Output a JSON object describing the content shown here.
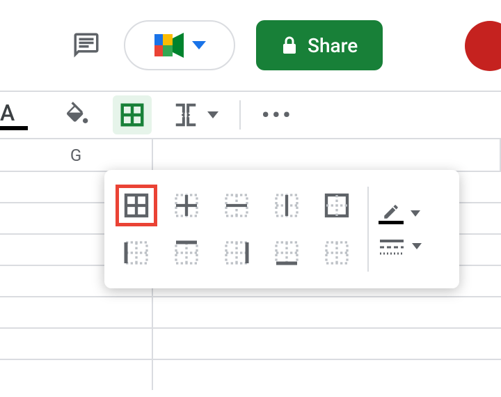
{
  "topbar": {
    "share_label": "Share",
    "lock_icon": "lock-icon",
    "meet_icon": "meet-icon",
    "comment_icon": "comment-icon"
  },
  "toolbar": {
    "text_color_letter": "A",
    "fill_icon": "paint-bucket-icon",
    "borders_icon": "borders-icon",
    "merge_icon": "merge-cells-icon",
    "more_label": "•••"
  },
  "columns": {
    "g_label": "G"
  },
  "borders_popup": {
    "items": [
      "border-all",
      "border-inner",
      "border-horizontal",
      "border-vertical",
      "border-outer",
      "border-left",
      "border-top",
      "border-right",
      "border-bottom",
      "border-clear"
    ],
    "highlighted": "border-all",
    "style": {
      "pen_icon": "pencil-icon",
      "style_icon": "border-style-icon"
    }
  }
}
